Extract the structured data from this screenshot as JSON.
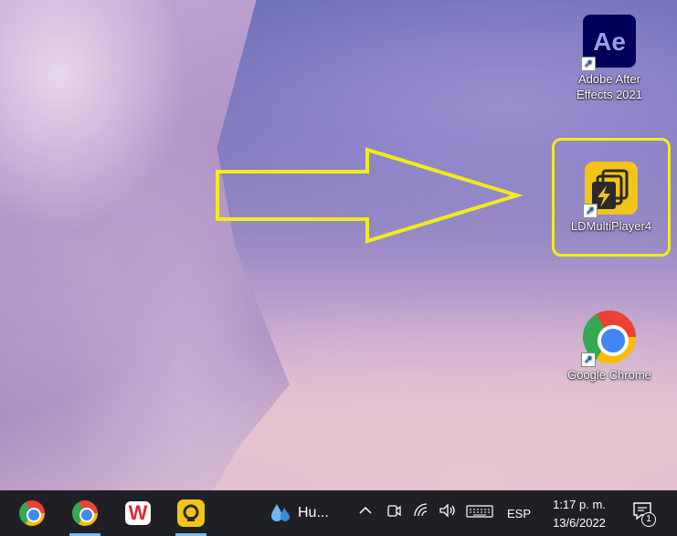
{
  "desktop": {
    "icons": [
      {
        "id": "after-effects",
        "label_line1": "Adobe After",
        "label_line2": "Effects 2021",
        "tile_text": "Ae"
      },
      {
        "id": "ldmultiplayer",
        "label": "LDMultiPlayer4"
      },
      {
        "id": "chrome",
        "label": "Google Chrome"
      }
    ],
    "annotation": {
      "arrow_color": "#f3ec1a",
      "highlight_color": "#f3ec1a"
    }
  },
  "taskbar": {
    "apps": [
      {
        "name": "Google Chrome",
        "icon": "chrome-icon"
      },
      {
        "name": "Chrome profile",
        "icon": "chrome-profile-icon"
      },
      {
        "name": "WPS Office",
        "icon": "wps-icon",
        "glyph": "W"
      },
      {
        "name": "LDPlayer",
        "icon": "ldplayer-icon"
      }
    ],
    "weather": {
      "text": "Hu..."
    },
    "language": "ESP",
    "time": "1:17 p. m.",
    "date": "13/6/2022",
    "notification_count": "1"
  }
}
